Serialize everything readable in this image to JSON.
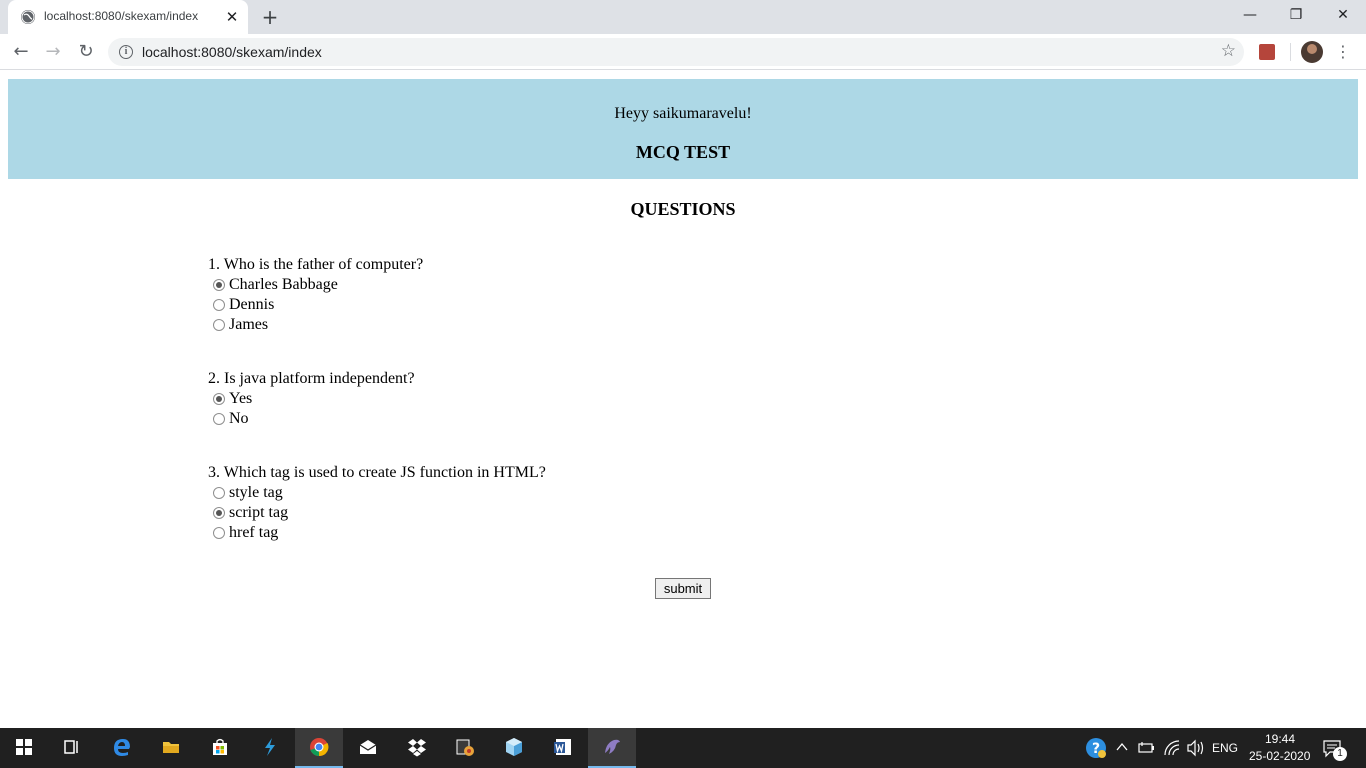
{
  "browser": {
    "tab_title": "localhost:8080/skexam/index",
    "tab_close": "✕",
    "new_tab": "+",
    "url": "localhost:8080/skexam/index",
    "window_controls": {
      "minimize": "—",
      "restore": "❐",
      "close": "✕"
    },
    "nav": {
      "back": "←",
      "forward": "→",
      "reload": "↻"
    },
    "bookmark_star": "☆",
    "menu": "⋮"
  },
  "header": {
    "greeting": "Heyy saikumaravelu!",
    "title": "MCQ TEST"
  },
  "questions_heading": "QUESTIONS",
  "questions": [
    {
      "text": "1. Who is the father of computer?",
      "options": [
        {
          "label": "Charles Babbage",
          "checked": true
        },
        {
          "label": "Dennis",
          "checked": false
        },
        {
          "label": "James",
          "checked": false
        }
      ]
    },
    {
      "text": "2. Is java platform independent?",
      "options": [
        {
          "label": "Yes",
          "checked": true
        },
        {
          "label": "No",
          "checked": false
        }
      ]
    },
    {
      "text": "3. Which tag is used to create JS function in HTML?",
      "options": [
        {
          "label": "style tag",
          "checked": false
        },
        {
          "label": "script tag",
          "checked": true
        },
        {
          "label": "href tag",
          "checked": false
        }
      ]
    }
  ],
  "submit_label": "submit",
  "taskbar": {
    "language": "ENG",
    "time": "19:44",
    "date": "25-02-2020",
    "notification_count": "1"
  },
  "colors": {
    "banner": "#add8e6",
    "taskbar": "#202020",
    "active_app_underline": "#76b9ed"
  }
}
